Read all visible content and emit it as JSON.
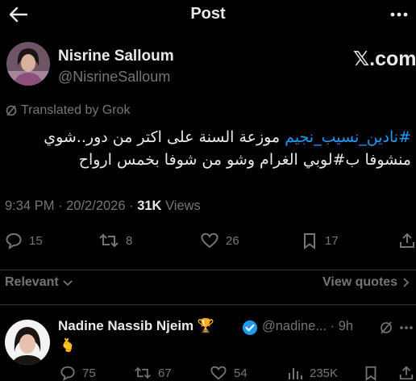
{
  "header": {
    "title": "Post"
  },
  "post": {
    "author_name": "Nisrine Salloum",
    "author_handle": "@NisrineSalloum",
    "brand": "𝕏.com",
    "translated_label": "Translated by Grok",
    "text_line1_hashtag": "#نادين_نسيب_نجيم",
    "text_line1_rest": " موزعة السنة على اكتر من دور..شوي",
    "text_line2_start": "منشوفا ب",
    "text_line2_hashtag": "#لوبي",
    "text_line2_rest": " الغرام وشو من شوفا بخمس ارواح",
    "time": "9:34 PM",
    "date": "20/2/2026",
    "views_count": "31K",
    "views_label": "Views",
    "replies": "15",
    "reposts": "8",
    "likes": "26",
    "bookmarks": "17"
  },
  "sort": {
    "relevant_label": "Relevant",
    "view_quotes_label": "View quotes"
  },
  "reply": {
    "author_name": "Nadine Nassib Njeim",
    "trophy": "🏆",
    "handle_time": "@nadine... · 9h",
    "emoji": "🫰",
    "replies": "75",
    "reposts": "67",
    "likes": "54",
    "views": "235K"
  },
  "colors": {
    "link": "#1d9bf0",
    "muted": "#71767b",
    "text": "#e7e9ea",
    "verified": "#1d9bf0"
  }
}
